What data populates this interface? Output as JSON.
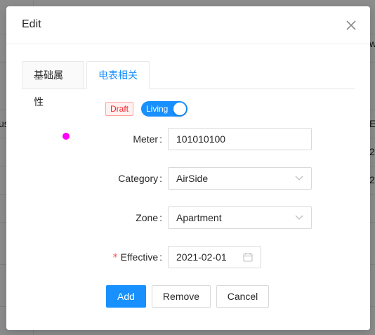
{
  "background": {
    "edge_texts": [
      "us",
      "w",
      "Ef",
      "20",
      "20"
    ]
  },
  "modal": {
    "title": "Edit"
  },
  "tabs": [
    {
      "label": "基础属性",
      "active": false
    },
    {
      "label": "电表相关",
      "active": true
    }
  ],
  "status": {
    "tag": "Draft",
    "switch_label": "Living",
    "switch_on": true
  },
  "form": {
    "meter": {
      "label": "Meter",
      "value": "101010100"
    },
    "category": {
      "label": "Category",
      "value": "AirSide"
    },
    "zone": {
      "label": "Zone",
      "value": "Apartment"
    },
    "effective": {
      "label": "Effective",
      "value": "2021-02-01",
      "required_mark": "*"
    },
    "colon": ":"
  },
  "buttons": {
    "add": "Add",
    "remove": "Remove",
    "cancel": "Cancel"
  },
  "colors": {
    "primary": "#1890ff",
    "danger": "#f5222d",
    "marker": "#ff00ff"
  }
}
